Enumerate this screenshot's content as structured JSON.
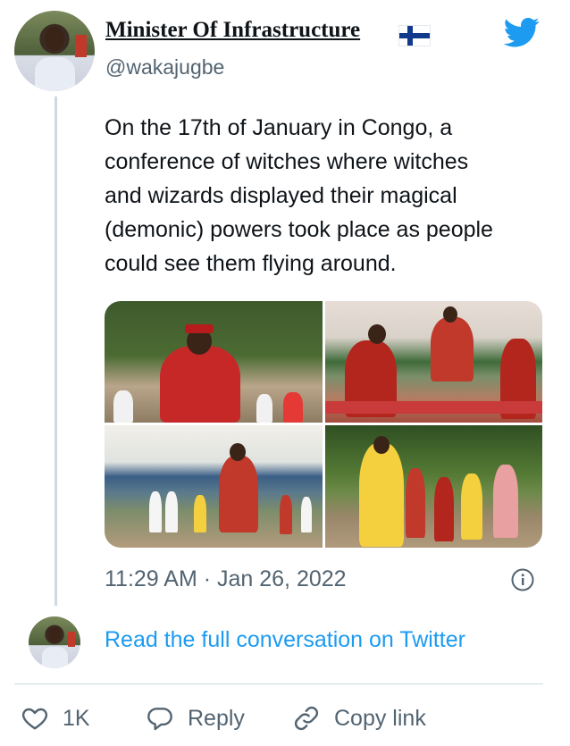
{
  "tweet": {
    "author_name": "Minister Of Infrastructure",
    "author_handle": "@wakajugbe",
    "text_lines": [
      "On the 17th of January in Congo, a",
      "conference of witches where witches",
      "and wizards displayed their magical",
      "(demonic) powers took place as people",
      "could see them flying around."
    ],
    "timestamp": "11:29 AM · Jan 26, 2022",
    "media_count": 4
  },
  "links": {
    "read_full": "Read the full conversation on Twitter"
  },
  "actions": {
    "like_count": "1K",
    "reply_label": "Reply",
    "copy_link_label": "Copy link"
  },
  "icons": {
    "brand": "twitter-bird-icon",
    "flag": "finland-flag-icon",
    "info": "info-icon",
    "like": "heart-icon",
    "reply": "reply-bubble-icon",
    "copy": "link-icon"
  },
  "colors": {
    "accent": "#1d9bf0",
    "text": "#0f1419",
    "muted": "#536471",
    "divider": "#cfd9de"
  }
}
